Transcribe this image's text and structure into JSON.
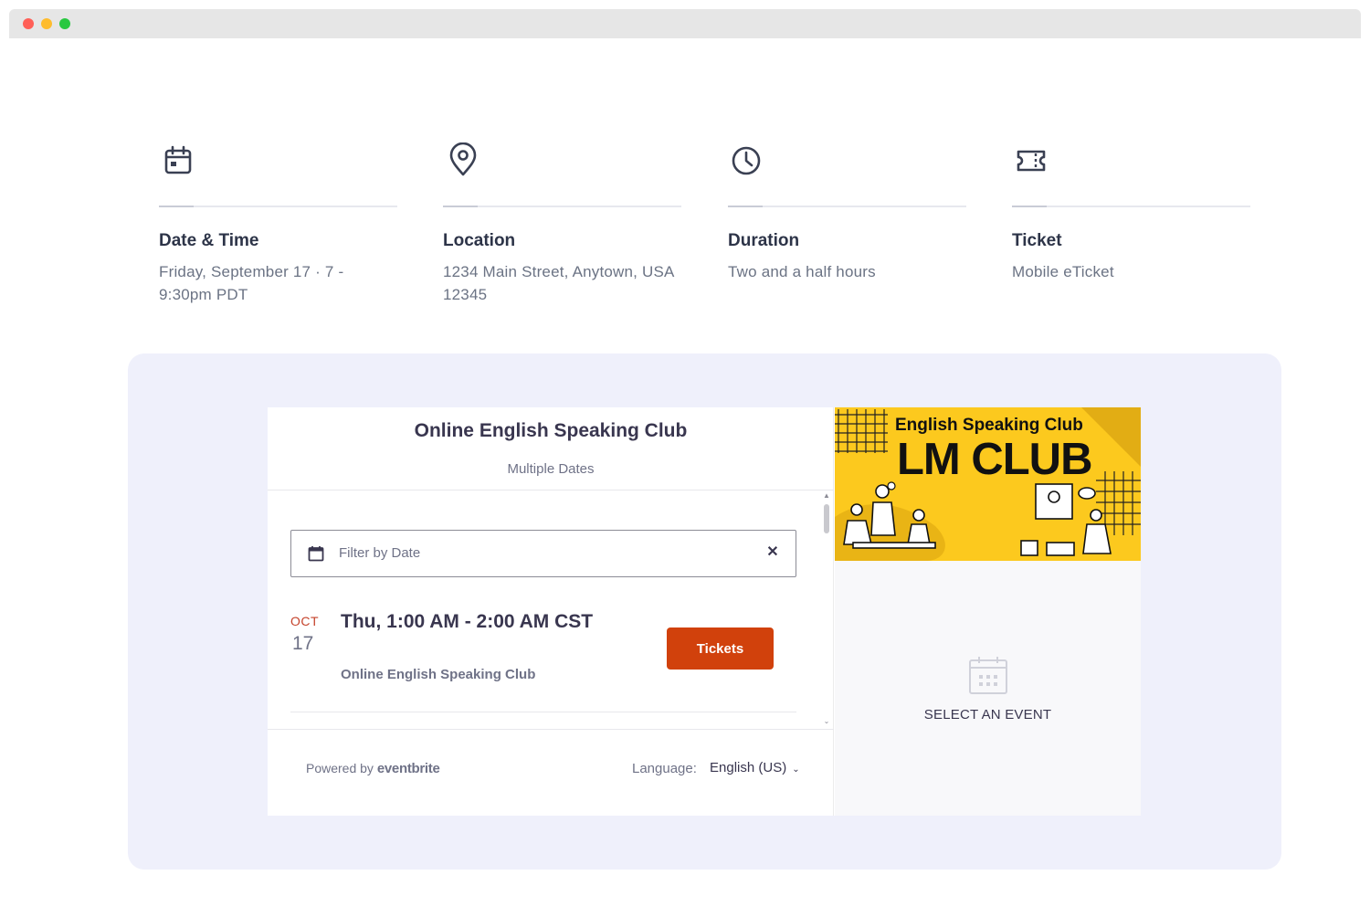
{
  "info": [
    {
      "icon": "calendar-icon",
      "label": "Date & Time",
      "value": "Friday, September 17 · 7 - 9:30pm PDT"
    },
    {
      "icon": "location-pin-icon",
      "label": "Location",
      "value": "1234 Main Street, Anytown, USA 12345"
    },
    {
      "icon": "clock-icon",
      "label": "Duration",
      "value": "Two and a half hours"
    },
    {
      "icon": "ticket-icon",
      "label": "Ticket",
      "value": "Mobile eTicket"
    }
  ],
  "widget": {
    "title": "Online English Speaking Club",
    "subtitle": "Multiple Dates",
    "filter_placeholder": "Filter by Date",
    "event": {
      "month": "OCT",
      "day": "17",
      "time": "Thu, 1:00 AM - 2:00 AM CST",
      "name": "Online English Speaking Club",
      "button": "Tickets"
    },
    "footer": {
      "powered_by": "Powered by",
      "brand": "eventbrite",
      "language_label": "Language:",
      "language_value": "English (US)"
    },
    "banner": {
      "line1": "English Speaking Club",
      "line2": "LM CLUB"
    },
    "select_event": "SELECT AN EVENT"
  },
  "colors": {
    "accent": "#d1410c",
    "panel_bg": "#eff0fb",
    "banner_bg": "#fcc91e",
    "month_red": "#c5432b"
  }
}
